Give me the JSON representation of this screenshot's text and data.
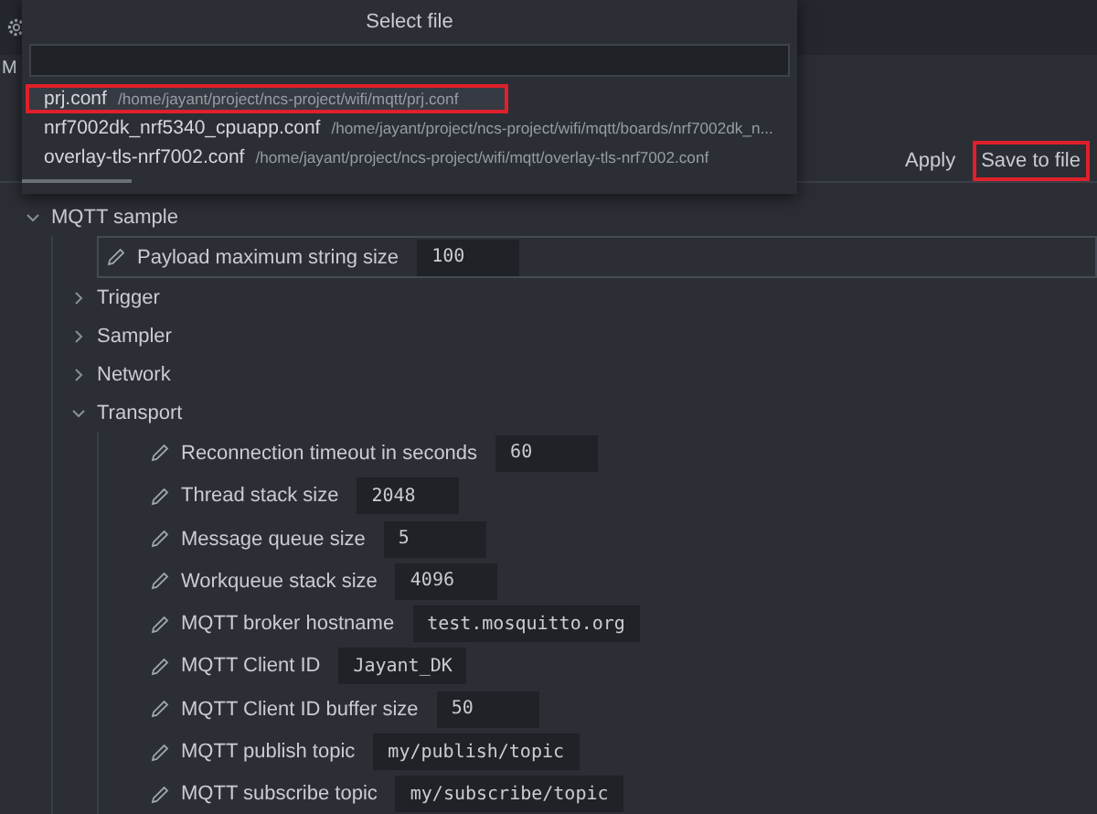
{
  "background_tab": {
    "label": "M"
  },
  "toolbar": {
    "buttons": [
      {
        "label": "Apply",
        "highlighted": false
      },
      {
        "label": "Save to file",
        "highlighted": true
      }
    ]
  },
  "tree": [
    {
      "kind": "group",
      "label": "MQTT sample",
      "expanded": true,
      "children": [
        {
          "kind": "setting",
          "label": "Payload maximum string size",
          "value": "100",
          "selected": true
        },
        {
          "kind": "group",
          "label": "Trigger",
          "expanded": false
        },
        {
          "kind": "group",
          "label": "Sampler",
          "expanded": false
        },
        {
          "kind": "group",
          "label": "Network",
          "expanded": false
        },
        {
          "kind": "group",
          "label": "Transport",
          "expanded": true,
          "children": [
            {
              "kind": "setting",
              "label": "Reconnection timeout in seconds",
              "value": "60",
              "selected": false
            },
            {
              "kind": "setting",
              "label": "Thread stack size",
              "value": "2048",
              "selected": false
            },
            {
              "kind": "setting",
              "label": "Message queue size",
              "value": "5",
              "selected": false
            },
            {
              "kind": "setting",
              "label": "Workqueue stack size",
              "value": "4096",
              "selected": false
            },
            {
              "kind": "setting",
              "label": "MQTT broker hostname",
              "value": "test.mosquitto.org",
              "selected": false
            },
            {
              "kind": "setting",
              "label": "MQTT Client ID",
              "value": "Jayant_DK",
              "selected": false
            },
            {
              "kind": "setting",
              "label": "MQTT Client ID buffer size",
              "value": "50",
              "selected": false
            },
            {
              "kind": "setting",
              "label": "MQTT publish topic",
              "value": "my/publish/topic",
              "selected": false
            },
            {
              "kind": "setting",
              "label": "MQTT subscribe topic",
              "value": "my/subscribe/topic",
              "selected": false
            }
          ]
        }
      ]
    }
  ],
  "dialog": {
    "title": "Select file",
    "files": [
      {
        "name": "prj.conf",
        "path": "/home/jayant/project/ncs-project/wifi/mqtt/prj.conf",
        "selected": true,
        "highlighted": true
      },
      {
        "name": "nrf7002dk_nrf5340_cpuapp.conf",
        "path": "/home/jayant/project/ncs-project/wifi/mqtt/boards/nrf7002dk_n...",
        "selected": false,
        "highlighted": false
      },
      {
        "name": "overlay-tls-nrf7002.conf",
        "path": "/home/jayant/project/ncs-project/wifi/mqtt/overlay-tls-nrf7002.conf",
        "selected": false,
        "highlighted": false
      }
    ]
  }
}
